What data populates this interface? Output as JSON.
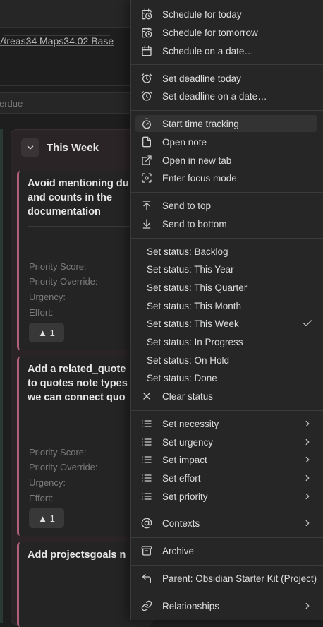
{
  "breadcrumb": {
    "items": [
      "Areas",
      "34 Maps",
      "34.02 Base"
    ],
    "separator": "/"
  },
  "filter": {
    "placeholder_text": "erdue"
  },
  "board": {
    "column_title": "This Week",
    "cards": [
      {
        "title": "Avoid mentioning du\nand counts in the\ndocumentation",
        "properties": [
          "Priority Score:",
          "Priority Override:",
          "Urgency:",
          "Effort:"
        ],
        "vote": "▲ 1"
      },
      {
        "title": "Add a related_quote\nto quotes note types\nwe can connect quo",
        "properties": [
          "Priority Score:",
          "Priority Override:",
          "Urgency:",
          "Effort:"
        ],
        "vote": "▲ 1"
      },
      {
        "title": "Add projectsgoals n",
        "properties": [],
        "vote": ""
      }
    ]
  },
  "menu": {
    "items": [
      {
        "label": "Schedule for today",
        "icon": "calendar-clock-icon"
      },
      {
        "label": "Schedule for tomorrow",
        "icon": "calendar-clock-icon"
      },
      {
        "label": "Schedule on a date…",
        "icon": "calendar-icon"
      },
      {
        "label": "Set deadline today",
        "icon": "alarm-clock-icon"
      },
      {
        "label": "Set deadline on a date…",
        "icon": "alarm-clock-icon"
      },
      {
        "label": "Start time tracking",
        "icon": "timer-icon"
      },
      {
        "label": "Open note",
        "icon": "file-icon"
      },
      {
        "label": "Open in new tab",
        "icon": "external-link-icon"
      },
      {
        "label": "Enter focus mode",
        "icon": "focus-icon"
      },
      {
        "label": "Send to top",
        "icon": "arrow-up-to-line-icon"
      },
      {
        "label": "Send to bottom",
        "icon": "arrow-down-to-line-icon"
      },
      {
        "label": "Set status: Backlog",
        "icon": ""
      },
      {
        "label": "Set status: This Year",
        "icon": ""
      },
      {
        "label": "Set status: This Quarter",
        "icon": ""
      },
      {
        "label": "Set status: This Month",
        "icon": ""
      },
      {
        "label": "Set status: This Week",
        "icon": "",
        "checked": true
      },
      {
        "label": "Set status: In Progress",
        "icon": ""
      },
      {
        "label": "Set status: On Hold",
        "icon": ""
      },
      {
        "label": "Set status: Done",
        "icon": ""
      },
      {
        "label": "Clear status",
        "icon": "x-icon"
      },
      {
        "label": "Set necessity",
        "icon": "list-icon",
        "submenu": true
      },
      {
        "label": "Set urgency",
        "icon": "list-icon",
        "submenu": true
      },
      {
        "label": "Set impact",
        "icon": "list-icon",
        "submenu": true
      },
      {
        "label": "Set effort",
        "icon": "list-icon",
        "submenu": true
      },
      {
        "label": "Set priority",
        "icon": "list-icon",
        "submenu": true
      },
      {
        "label": "Contexts",
        "icon": "at-sign-icon",
        "submenu": true
      },
      {
        "label": "Archive",
        "icon": "archive-icon"
      },
      {
        "label": "Parent: Obsidian Starter Kit (Project)",
        "icon": "corner-up-left-icon"
      },
      {
        "label": "Relationships",
        "icon": "link-icon",
        "submenu": true
      }
    ]
  },
  "colors": {
    "background": "#1e1e1e",
    "menu_background": "#262626",
    "column_background": "#2a2426",
    "card_accent": "#b0607a",
    "text": "#dcddde",
    "muted_text": "#7a7a7a"
  }
}
